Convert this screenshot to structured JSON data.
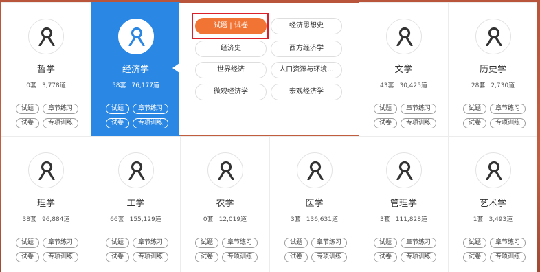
{
  "subjects": [
    {
      "name": "哲学",
      "sets": "0套",
      "questions": "3,778道",
      "tags": [
        "试题",
        "章节练习",
        "试卷",
        "专项训练"
      ]
    },
    {
      "name": "经济学",
      "sets": "58套",
      "questions": "76,177道",
      "tags": [
        "试题",
        "章节练习",
        "试卷",
        "专项训练"
      ]
    },
    {
      "name": "文学",
      "sets": "43套",
      "questions": "30,425道",
      "tags": [
        "试题",
        "章节练习",
        "试卷",
        "专项训练"
      ]
    },
    {
      "name": "历史学",
      "sets": "28套",
      "questions": "2,730道",
      "tags": [
        "试题",
        "章节练习",
        "试卷",
        "专项训练"
      ]
    },
    {
      "name": "理学",
      "sets": "38套",
      "questions": "96,884道",
      "tags": [
        "试题",
        "章节练习",
        "试卷",
        "专项训练"
      ]
    },
    {
      "name": "工学",
      "sets": "66套",
      "questions": "155,129道",
      "tags": [
        "试题",
        "章节练习",
        "试卷",
        "专项训练"
      ]
    },
    {
      "name": "农学",
      "sets": "0套",
      "questions": "12,019道",
      "tags": [
        "试题",
        "章节练习",
        "试卷",
        "专项训练"
      ]
    },
    {
      "name": "医学",
      "sets": "3套",
      "questions": "136,631道",
      "tags": [
        "试题",
        "章节练习",
        "试卷",
        "专项训练"
      ]
    },
    {
      "name": "管理学",
      "sets": "3套",
      "questions": "111,828道",
      "tags": [
        "试题",
        "章节练习",
        "试卷",
        "专项训练"
      ]
    },
    {
      "name": "艺术学",
      "sets": "1套",
      "questions": "3,493道",
      "tags": [
        "试题",
        "章节练习",
        "试卷",
        "专项训练"
      ]
    }
  ],
  "popup": {
    "items": [
      "试题 | 试卷",
      "经济思想史",
      "经济史",
      "西方经济学",
      "世界经济",
      "人口资源与环境...",
      "微观经济学",
      "宏观经济学"
    ]
  },
  "icon": "user-icon",
  "colors": {
    "active": "#2b87e4",
    "accent": "#f27434",
    "highlight": "#d9202b"
  }
}
